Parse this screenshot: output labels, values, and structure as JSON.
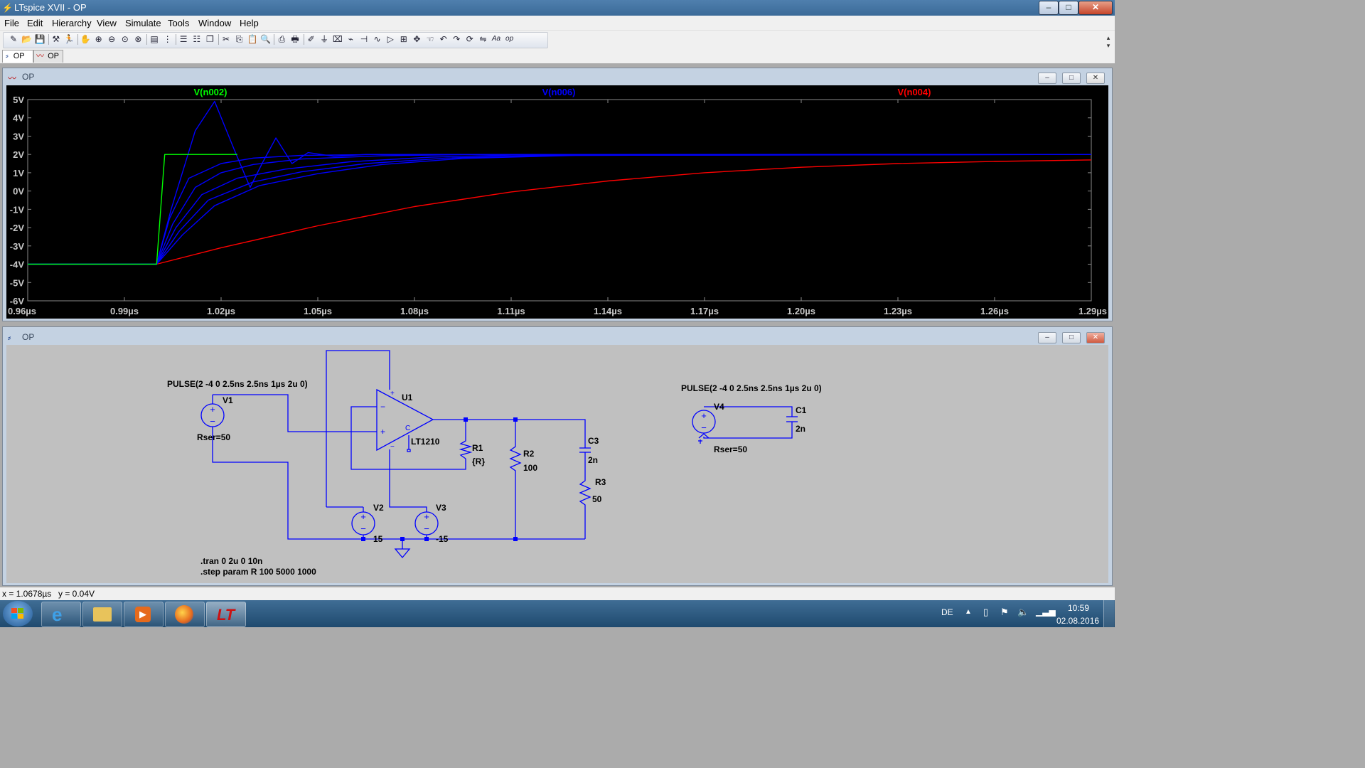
{
  "window": {
    "title": "LTspice XVII - OP",
    "min_label": "–",
    "max_label": "□",
    "close_label": "✕"
  },
  "menu": [
    "File",
    "Edit",
    "Hierarchy",
    "View",
    "Simulate",
    "Tools",
    "Window",
    "Help"
  ],
  "toolbar_icons": [
    "new-schematic-icon",
    "open-icon",
    "save-icon",
    "control-panel-icon",
    "run-icon",
    "halt-icon",
    "zoom-in-icon",
    "zoom-out-icon",
    "zoom-fit-icon",
    "zoom-cancel-icon",
    "autorange-icon",
    "grid-icon",
    "tile-horizontal-icon",
    "tile-vertical-icon",
    "cascade-icon",
    "cut-icon",
    "copy-icon",
    "paste-icon",
    "find-icon",
    "print-preview-icon",
    "print-icon",
    "draw-wire-icon",
    "ground-icon",
    "label-net-icon",
    "resistor-icon",
    "capacitor-icon",
    "inductor-icon",
    "diode-icon",
    "component-icon",
    "move-icon",
    "drag-icon",
    "undo-icon",
    "redo-icon",
    "rotate-icon",
    "mirror-icon",
    "text-icon",
    "spice-directive-icon"
  ],
  "tabs": [
    {
      "label": "OP",
      "icon": "schematic-icon",
      "active": true
    },
    {
      "label": "OP",
      "icon": "waveform-icon",
      "active": false
    }
  ],
  "waveform_window": {
    "title": "OP"
  },
  "schematic_window": {
    "title": "OP"
  },
  "chart_data": {
    "type": "line",
    "ylim": [
      -6,
      5
    ],
    "xlim": [
      0.96,
      1.29
    ],
    "y_ticks": [
      "5V",
      "4V",
      "3V",
      "2V",
      "1V",
      "0V",
      "-1V",
      "-2V",
      "-3V",
      "-4V",
      "-5V",
      "-6V"
    ],
    "x_ticks": [
      "0.96µs",
      "0.99µs",
      "1.02µs",
      "1.05µs",
      "1.08µs",
      "1.11µs",
      "1.14µs",
      "1.17µs",
      "1.20µs",
      "1.23µs",
      "1.26µs",
      "1.29µs"
    ],
    "x_tick_values": [
      0.96,
      0.99,
      1.02,
      1.05,
      1.08,
      1.11,
      1.14,
      1.17,
      1.2,
      1.23,
      1.26,
      1.29
    ],
    "series": [
      {
        "name": "V(n002)",
        "color": "#00ff00",
        "x": [
          0.96,
          1.0,
          1.0025,
          1.025
        ],
        "y": [
          -4,
          -4,
          2,
          2
        ]
      },
      {
        "name": "V(n006)",
        "color": "#0000ff",
        "runs": [
          {
            "x": [
              0.96,
              1.0,
              1.0045,
              1.012,
              1.018,
              1.024,
              1.029,
              1.033,
              1.037,
              1.042,
              1.047,
              1.055,
              1.065,
              1.29
            ],
            "y": [
              -4,
              -4,
              -1,
              3.3,
              4.9,
              2.3,
              0.2,
              1.6,
              2.9,
              1.5,
              2.1,
              1.9,
              2.0,
              2.0
            ]
          },
          {
            "x": [
              0.96,
              1.0,
              1.004,
              1.01,
              1.02,
              1.03,
              1.045,
              1.07,
              1.12,
              1.29
            ],
            "y": [
              -4,
              -4,
              -1.5,
              0.7,
              1.5,
              1.8,
              1.95,
              2.0,
              2.0,
              2.0
            ]
          },
          {
            "x": [
              0.96,
              1.0,
              1.005,
              1.012,
              1.02,
              1.03,
              1.045,
              1.07,
              1.1,
              1.29
            ],
            "y": [
              -4,
              -4,
              -1.8,
              0.2,
              1.0,
              1.45,
              1.75,
              1.93,
              2.0,
              2.0
            ]
          },
          {
            "x": [
              0.96,
              1.0,
              1.006,
              1.014,
              1.025,
              1.04,
              1.06,
              1.085,
              1.11,
              1.29
            ],
            "y": [
              -4,
              -4,
              -2.0,
              -0.2,
              0.7,
              1.2,
              1.6,
              1.85,
              1.97,
              2.0
            ]
          },
          {
            "x": [
              0.96,
              1.0,
              1.007,
              1.016,
              1.03,
              1.045,
              1.065,
              1.09,
              1.12,
              1.29
            ],
            "y": [
              -4,
              -4,
              -2.2,
              -0.5,
              0.5,
              1.05,
              1.5,
              1.8,
              1.95,
              2.0
            ]
          },
          {
            "x": [
              0.96,
              1.0,
              1.008,
              1.018,
              1.032,
              1.05,
              1.07,
              1.095,
              1.13,
              1.29
            ],
            "y": [
              -4,
              -4,
              -2.4,
              -0.8,
              0.3,
              0.95,
              1.45,
              1.78,
              1.95,
              2.0
            ]
          }
        ]
      },
      {
        "name": "V(n004)",
        "color": "#ff0000",
        "x": [
          0.96,
          1.0,
          1.02,
          1.05,
          1.08,
          1.11,
          1.14,
          1.17,
          1.2,
          1.23,
          1.26,
          1.29
        ],
        "y": [
          -4,
          -4,
          -3.1,
          -1.9,
          -0.85,
          -0.05,
          0.55,
          1.0,
          1.3,
          1.5,
          1.62,
          1.7
        ]
      }
    ]
  },
  "schematic": {
    "v1_label": "V1",
    "v1_value": "PULSE(2 -4 0 2.5ns 2.5ns 1µs 2u 0)",
    "v1_rser": "Rser=50",
    "u1_label": "U1",
    "u1_part": "LT1210",
    "r1_label": "R1",
    "r1_value": "{R}",
    "r2_label": "R2",
    "r2_value": "100",
    "c3_label": "C3",
    "c3_value": "2n",
    "r3_label": "R3",
    "r3_value": "50",
    "v2_label": "V2",
    "v2_value": "15",
    "v3_label": "V3",
    "v3_value": "-15",
    "v4_label": "V4",
    "v4_value": "PULSE(2 -4 0 2.5ns 2.5ns 1µs 2u 0)",
    "v4_rser": "Rser=50",
    "c1_label": "C1",
    "c1_value": "2n",
    "directive1": ".tran 0 2u 0 10n",
    "directive2": ".step param R 100 5000 1000"
  },
  "status": {
    "x_readout": "x = 1.0678µs",
    "y_readout": "y = 0.04V"
  },
  "taskbar": {
    "language": "DE",
    "time": "10:59",
    "date": "02.08.2016"
  }
}
